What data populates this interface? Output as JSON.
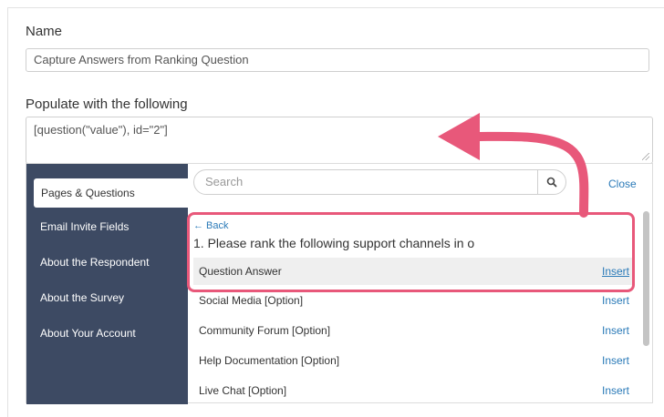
{
  "form": {
    "name_label": "Name",
    "name_value": "Capture Answers from Ranking Question",
    "populate_label": "Populate with the following",
    "populate_value": "[question(\"value\"), id=\"2\"]"
  },
  "picker": {
    "sidebar": [
      {
        "label": "Pages & Questions",
        "active": true
      },
      {
        "label": "Email Invite Fields",
        "active": false
      },
      {
        "label": "About the Respondent",
        "active": false
      },
      {
        "label": "About the Survey",
        "active": false
      },
      {
        "label": "About Your Account",
        "active": false
      }
    ],
    "search_placeholder": "Search",
    "close_label": "Close",
    "back_label": "← Back",
    "question_title": "1. Please rank the following support channels in o",
    "rows": [
      {
        "label": "Question Answer",
        "action": "Insert"
      },
      {
        "label": "Social Media [Option]",
        "action": "Insert"
      },
      {
        "label": "Community Forum [Option]",
        "action": "Insert"
      },
      {
        "label": "Help Documentation [Option]",
        "action": "Insert"
      },
      {
        "label": "Live Chat [Option]",
        "action": "Insert"
      }
    ]
  },
  "icons": {
    "search": "search-icon",
    "arrow": "annotation-arrow"
  },
  "colors": {
    "accent": "#e8587a",
    "link": "#2a7ab8",
    "sidebar": "#3d4a63"
  }
}
